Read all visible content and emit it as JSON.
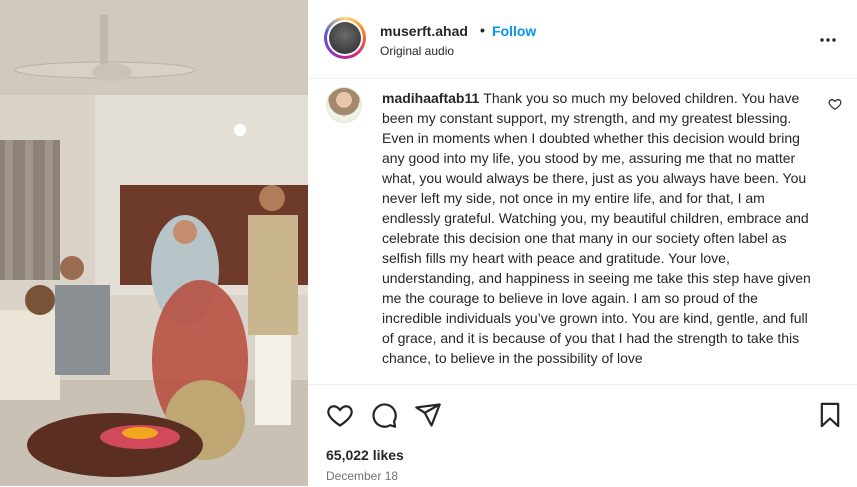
{
  "post": {
    "username": "muserft.ahad",
    "separator": "•",
    "follow_label": "Follow",
    "audio": "Original audio",
    "more_label": "•••"
  },
  "comment": {
    "username": "madihaaftab11",
    "text": "Thank you so much my beloved children. You have been my constant support, my strength, and my greatest blessing. Even in moments when I doubted whether this decision would bring any good into my life, you stood by me, assuring me that no matter what, you would always be there, just as you always have been. You never left my side, not once in my entire life, and for that, I am endlessly grateful. Watching you, my beautiful children, embrace and celebrate this decision one that many in our society often label as selfish fills my heart with peace and gratitude. Your love, understanding, and happiness in seeing me take this step have given me the courage to believe in love again. I am so proud of the incredible individuals you’ve grown into. You are kind, gentle, and full of grace, and it is because of you that I had the strength to take this chance, to believe in the possibility of love"
  },
  "stats": {
    "likes": "65,022 likes",
    "date": "December 18"
  },
  "icons": {
    "like": "heart-icon",
    "comment": "comment-icon",
    "share": "share-icon",
    "save": "bookmark-icon",
    "comment_like": "heart-icon"
  }
}
